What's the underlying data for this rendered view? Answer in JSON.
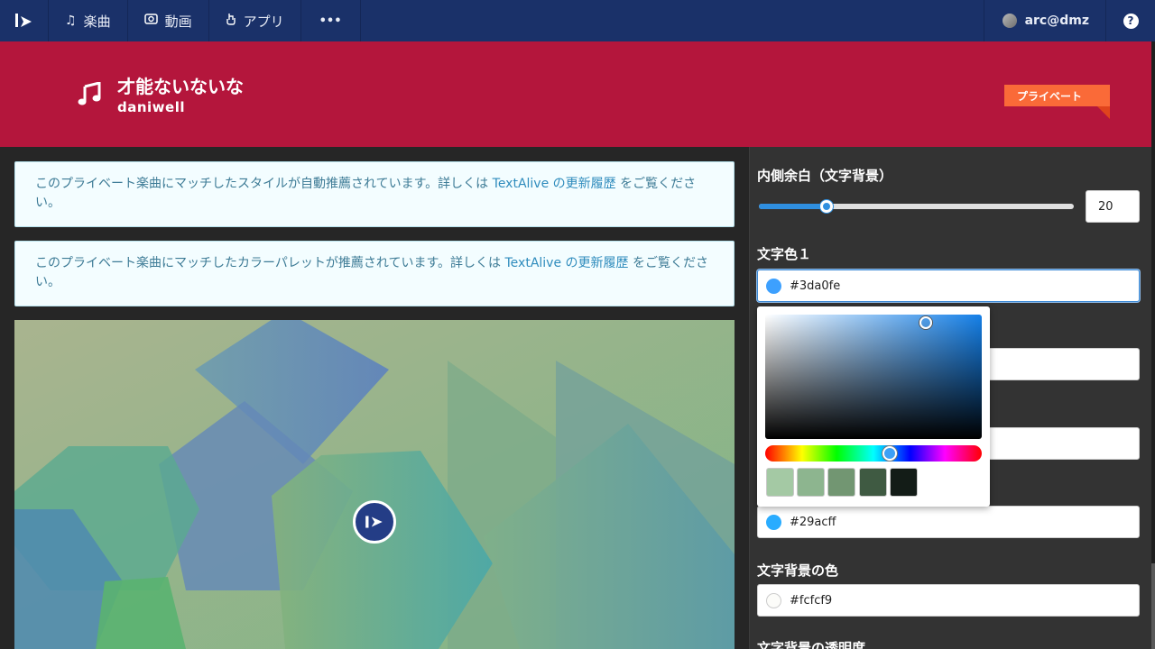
{
  "nav": {
    "items": [
      {
        "label": "楽曲",
        "icon": "music-note-icon"
      },
      {
        "label": "動画",
        "icon": "video-icon"
      },
      {
        "label": "アプリ",
        "icon": "app-hand-icon"
      }
    ],
    "more": "•••",
    "user": "arc@dmz",
    "help": "?"
  },
  "song": {
    "title": "才能ないないな",
    "artist": "daniwell",
    "tag": "プライベート"
  },
  "notices": [
    {
      "before": "このプライベート楽曲にマッチしたスタイルが自動推薦されています。詳しくは ",
      "link": "TextAlive の更新履歴",
      "after": " をご覧ください。"
    },
    {
      "before": "このプライベート楽曲にマッチしたカラーパレットが推薦されています。詳しくは ",
      "link": "TextAlive の更新履歴",
      "after": " をご覧ください。"
    }
  ],
  "panel": {
    "padding_label": "内側余白（文字背景）",
    "padding_value": "20",
    "padding_fraction": 0.2,
    "text_color1_label": "文字色１",
    "text_color1_value": "#3da0fe",
    "text_color2_value": "#29acff",
    "text_bg_color_label": "文字背景の色",
    "text_bg_color_value": "#fcfcf9",
    "text_bg_opacity_label": "文字背景の透明度"
  },
  "colors": {
    "nav_bg": "#1a3169",
    "banner_bg": "#b4163c",
    "tag_bg": "#fa6a38",
    "accent": "#2f8fe0",
    "presets": [
      "#a4c9a4",
      "#8db58f",
      "#729672",
      "#3f5a42",
      "#131c17"
    ]
  }
}
